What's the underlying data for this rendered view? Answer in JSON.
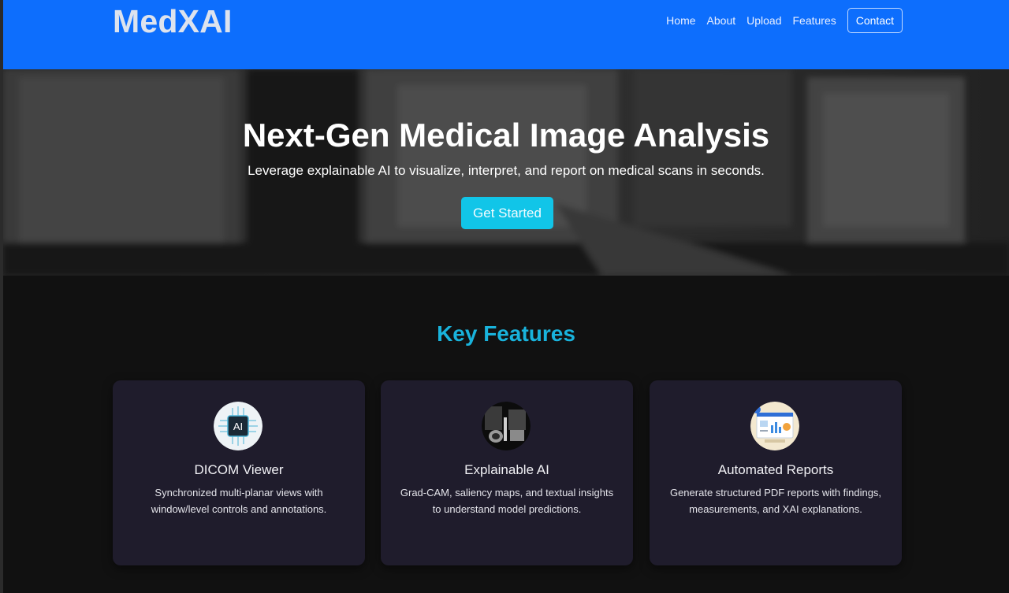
{
  "navbar": {
    "brand": "MedXAI",
    "links": [
      "Home",
      "About",
      "Upload",
      "Features"
    ],
    "contact": "Contact"
  },
  "hero": {
    "title": "Next-Gen Medical Image Analysis",
    "subtitle": "Leverage explainable AI to visualize, interpret, and report on medical scans in seconds.",
    "cta": "Get Started"
  },
  "features": {
    "title": "Key Features",
    "cards": [
      {
        "icon": "ai-chip-icon",
        "icon_text": "AI",
        "title": "DICOM Viewer",
        "text": "Synchronized multi-planar views with window/level controls and annotations."
      },
      {
        "icon": "brain-scan-icon",
        "title": "Explainable AI",
        "text": "Grad-CAM, saliency maps, and textual insights to understand model predictions."
      },
      {
        "icon": "report-dashboard-icon",
        "title": "Automated Reports",
        "text": "Generate structured PDF reports with findings, measurements, and XAI explanations."
      }
    ]
  },
  "colors": {
    "navbar": "#0d6efd",
    "accent": "#19b3dc",
    "cta": "#11c5e8",
    "card": "#1f1c2c",
    "background": "#111111"
  }
}
